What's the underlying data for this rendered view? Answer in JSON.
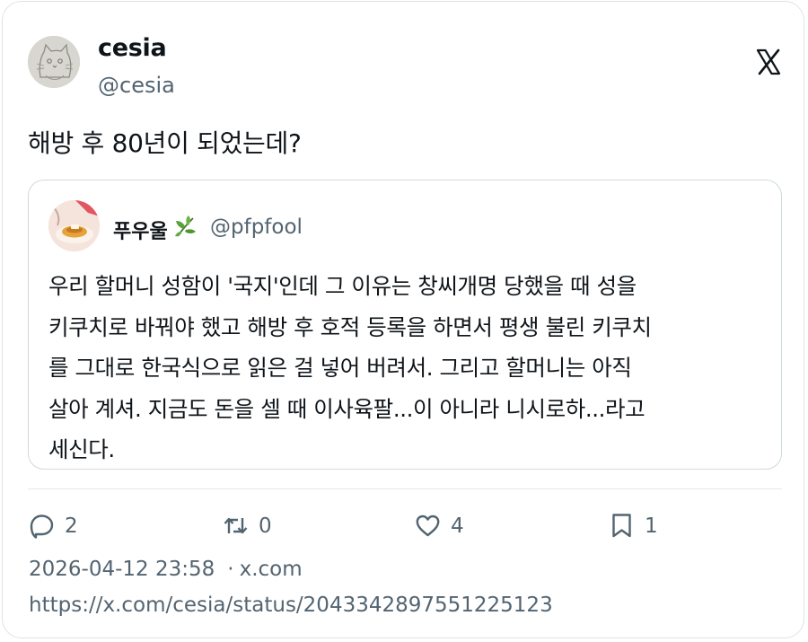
{
  "post": {
    "author": {
      "display_name": "cesia",
      "handle": "@cesia",
      "avatar_icon": "cat-sketch-avatar"
    },
    "platform_icon": "x-logo-icon",
    "text": "해방 후 80년이 되었는데?",
    "quoted": {
      "author": {
        "display_name": "푸우울",
        "name_emoji_icon": "herb-leaf-icon",
        "handle": "@pfpfool",
        "avatar_icon": "food-photo-avatar"
      },
      "lines": [
        "우리 할머니 성함이 '국지'인데 그 이유는 창씨개명 당했을 때 성을",
        "키쿠치로 바꿔야 했고 해방 후 호적 등록을 하면서 평생 불린 키쿠치",
        "를 그대로 한국식으로 읽은 걸 넣어 버려서. 그리고 할머니는 아직",
        "살아 계셔. 지금도 돈을 셀 때 이사육팔...이 아니라 니시로하...라고",
        "세신다."
      ]
    },
    "actions": {
      "replies": "2",
      "reposts": "0",
      "likes": "4",
      "bookmarks": "1"
    },
    "timestamp": "2026-04-12 23:58",
    "separator": "·",
    "source": "x.com",
    "url": "https://x.com/cesia/status/2043342897551225123"
  },
  "colors": {
    "text_primary": "#0f1419",
    "text_secondary": "#536471",
    "border": "#cfd9de",
    "divider": "#e4e7e9"
  }
}
